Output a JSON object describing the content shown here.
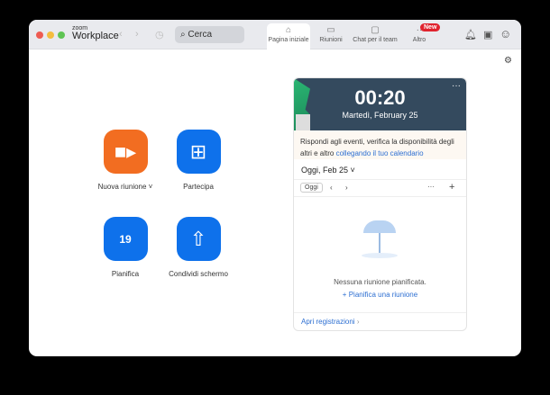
{
  "app": {
    "brand_small": "zoom",
    "brand": "Workplace"
  },
  "search": {
    "placeholder": "Cerca"
  },
  "tabs": [
    {
      "label": "Pagina iniziale",
      "icon": "home-icon"
    },
    {
      "label": "Riunioni",
      "icon": "video-icon"
    },
    {
      "label": "Chat per il team",
      "icon": "chat-icon"
    },
    {
      "label": "Altro",
      "icon": "more-icon"
    }
  ],
  "badge_new": "New",
  "actions": [
    {
      "label": "Nuova riunione",
      "color": "#f26d21"
    },
    {
      "label": "Partecipa",
      "color": "#0e71eb"
    },
    {
      "label": "Pianifica",
      "color": "#0e71eb",
      "day": "19"
    },
    {
      "label": "Condividi schermo",
      "color": "#0e71eb"
    }
  ],
  "panel": {
    "time": "00:20",
    "date": "Martedì, February 25",
    "info_text": "Rispondi agli eventi, verifica la disponibilità degli altri e altro ",
    "info_link": "collegando il tuo calendario",
    "day_select": "Oggi, Feb 25",
    "today_button": "Oggi",
    "empty": "Nessuna riunione pianificata.",
    "schedule_link": "Pianifica una riunione",
    "recordings_link": "Apri registrazioni"
  }
}
